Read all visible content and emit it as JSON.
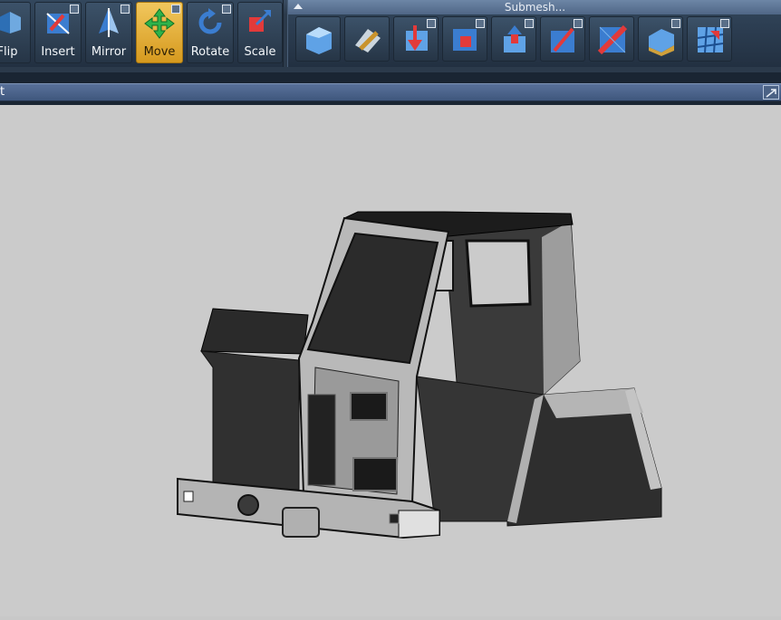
{
  "ribbon": {
    "tools": [
      {
        "label": "Flip",
        "icon": "flip-icon"
      },
      {
        "label": "Insert",
        "icon": "insert-icon"
      },
      {
        "label": "Mirror",
        "icon": "mirror-icon"
      },
      {
        "label": "Move",
        "icon": "move-icon",
        "active": true
      },
      {
        "label": "Rotate",
        "icon": "rotate-icon"
      },
      {
        "label": "Scale",
        "icon": "scale-icon"
      }
    ],
    "submesh": {
      "title": "Submesh...",
      "buttons": [
        "submesh-shell-icon",
        "submesh-brush-icon",
        "submesh-push-icon",
        "submesh-split-icon",
        "submesh-extrude-icon",
        "submesh-cut-icon",
        "submesh-triangulate-icon",
        "submesh-bevel-icon",
        "submesh-grid-icon"
      ]
    }
  },
  "viewport": {
    "title": "t",
    "colors": {
      "background": "#cbcbcb",
      "model_dark": "#2e2e2e",
      "model_light": "#c9c9c9"
    }
  }
}
